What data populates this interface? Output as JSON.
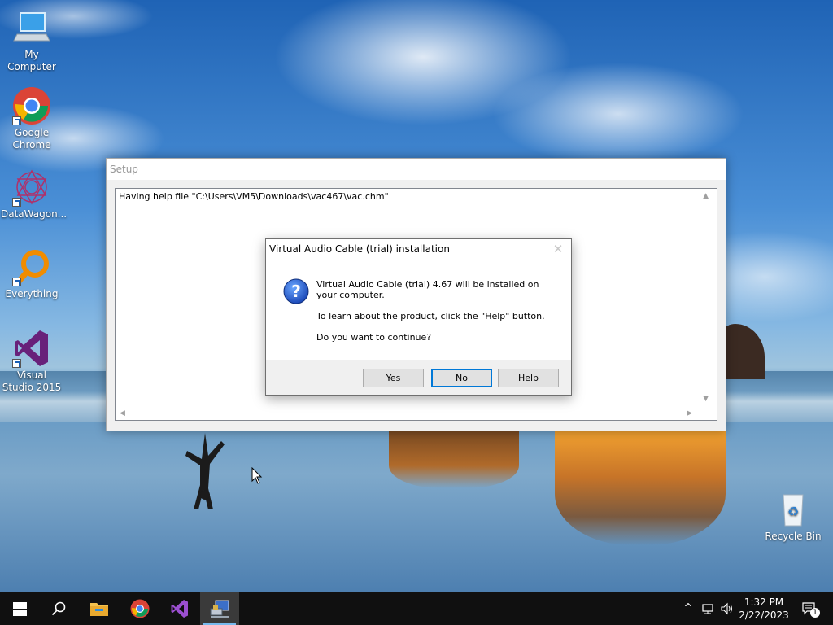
{
  "desktop": {
    "icons": [
      {
        "label": "My Computer",
        "icon": "computer-icon"
      },
      {
        "label": "Google Chrome",
        "icon": "chrome-icon"
      },
      {
        "label": "DataWagon...",
        "icon": "datawagon-icon"
      },
      {
        "label": "Everything",
        "icon": "everything-search-icon"
      },
      {
        "label": "Visual Studio 2015",
        "icon": "visual-studio-icon"
      },
      {
        "label": "Recycle Bin",
        "icon": "recycle-bin-icon"
      }
    ]
  },
  "setup_window": {
    "title": "Setup",
    "log_text": "Having help file \"C:\\Users\\VM5\\Downloads\\vac467\\vac.chm\""
  },
  "message_box": {
    "title": "Virtual Audio Cable (trial) installation",
    "close_glyph": "✕",
    "icon": "question-icon",
    "line1": "Virtual Audio Cable (trial) 4.67 will be installed on your computer.",
    "line2": "To learn about the product, click the \"Help\" button.",
    "line3": "Do you want to continue?",
    "buttons": {
      "yes": "Yes",
      "no": "No",
      "help": "Help"
    },
    "default_button": "no"
  },
  "taskbar": {
    "items": [
      {
        "name": "start",
        "icon": "windows-start-icon"
      },
      {
        "name": "search",
        "icon": "search-icon"
      },
      {
        "name": "file-explorer",
        "icon": "folder-icon"
      },
      {
        "name": "chrome",
        "icon": "chrome-icon"
      },
      {
        "name": "visual-studio",
        "icon": "visual-studio-icon"
      },
      {
        "name": "setup",
        "icon": "setup-installer-icon",
        "active": true
      }
    ],
    "time": "1:32 PM",
    "date": "2/22/2023",
    "notification_count": "1"
  },
  "colors": {
    "accent": "#0078d7",
    "taskbar_bg": "#101010",
    "dialog_footer": "#f0f0f0"
  }
}
